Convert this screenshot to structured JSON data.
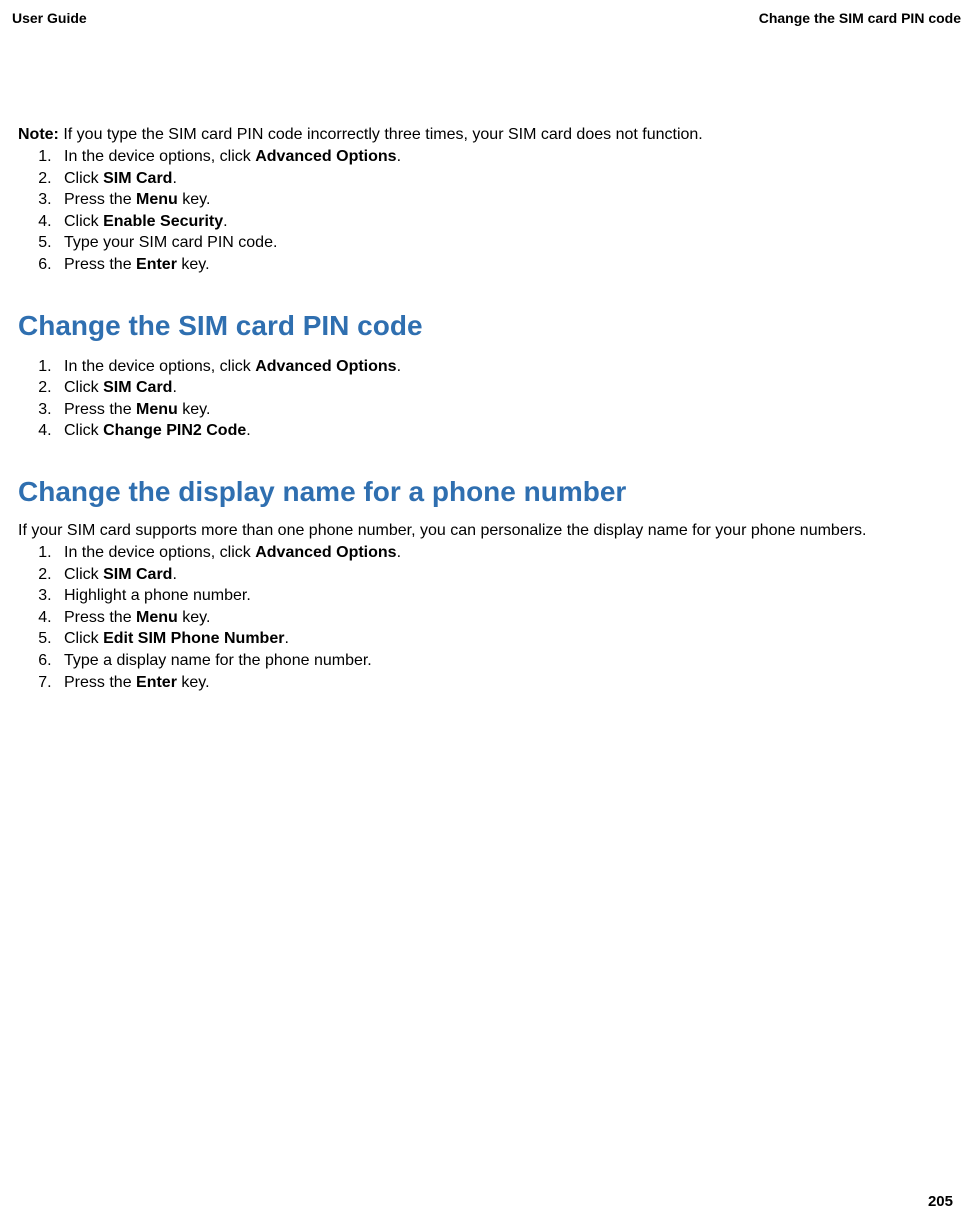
{
  "header": {
    "left": "User Guide",
    "right": "Change the SIM card PIN code"
  },
  "note": {
    "label": "Note:",
    "text": "  If you type the SIM card PIN code incorrectly three times, your SIM card does not function."
  },
  "section0": {
    "steps": [
      {
        "prefix": "In the device options, click ",
        "bold": "Advanced Options",
        "suffix": "."
      },
      {
        "prefix": "Click ",
        "bold": "SIM Card",
        "suffix": "."
      },
      {
        "prefix": "Press the ",
        "bold": "Menu",
        "suffix": " key."
      },
      {
        "prefix": "Click ",
        "bold": "Enable Security",
        "suffix": "."
      },
      {
        "prefix": "Type your SIM card PIN code.",
        "bold": "",
        "suffix": ""
      },
      {
        "prefix": "Press the ",
        "bold": "Enter",
        "suffix": " key."
      }
    ]
  },
  "section1": {
    "heading": "Change the SIM card PIN code",
    "steps": [
      {
        "prefix": "In the device options, click ",
        "bold": "Advanced Options",
        "suffix": "."
      },
      {
        "prefix": "Click ",
        "bold": "SIM Card",
        "suffix": "."
      },
      {
        "prefix": "Press the ",
        "bold": "Menu",
        "suffix": " key."
      },
      {
        "prefix": "Click ",
        "bold": "Change PIN2 Code",
        "suffix": "."
      }
    ]
  },
  "section2": {
    "heading": "Change the display name for a phone number",
    "intro": "If your SIM card supports more than one phone number, you can personalize the display name for your phone numbers.",
    "steps": [
      {
        "prefix": "In the device options, click ",
        "bold": "Advanced Options",
        "suffix": "."
      },
      {
        "prefix": "Click ",
        "bold": "SIM Card",
        "suffix": "."
      },
      {
        "prefix": "Highlight a phone number.",
        "bold": "",
        "suffix": ""
      },
      {
        "prefix": "Press the ",
        "bold": "Menu",
        "suffix": " key."
      },
      {
        "prefix": "Click ",
        "bold": "Edit SIM Phone Number",
        "suffix": "."
      },
      {
        "prefix": "Type a display name for the phone number.",
        "bold": "",
        "suffix": ""
      },
      {
        "prefix": "Press the ",
        "bold": "Enter",
        "suffix": " key."
      }
    ]
  },
  "page_number": "205"
}
